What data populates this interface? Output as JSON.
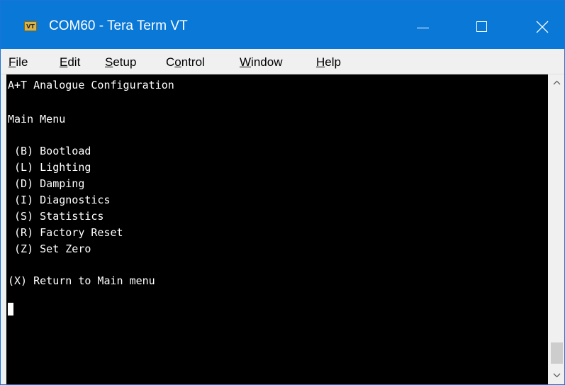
{
  "window": {
    "title": "COM60 - Tera Term VT",
    "icon_text": "VT"
  },
  "menu": [
    {
      "first": "F",
      "rest": "ile"
    },
    {
      "first": "E",
      "rest": "dit"
    },
    {
      "first": "S",
      "rest": "etup"
    },
    {
      "pre": "C",
      "first": "o",
      "rest": "ntrol"
    },
    {
      "first": "W",
      "rest": "indow"
    },
    {
      "first": "H",
      "rest": "elp"
    }
  ],
  "terminal": {
    "lines": [
      "A+T Analogue Configuration",
      "",
      "Main Menu",
      "",
      " (B) Bootload",
      " (L) Lighting",
      " (D) Damping",
      " (I) Diagnostics",
      " (S) Statistics",
      " (R) Factory Reset",
      " (Z) Set Zero",
      "",
      "(X) Return to Main menu"
    ]
  },
  "icons": {
    "minimize": "minimize-icon",
    "maximize": "maximize-icon",
    "close": "close-icon",
    "scroll_up": "chevron-up-icon",
    "scroll_down": "chevron-down-icon"
  }
}
